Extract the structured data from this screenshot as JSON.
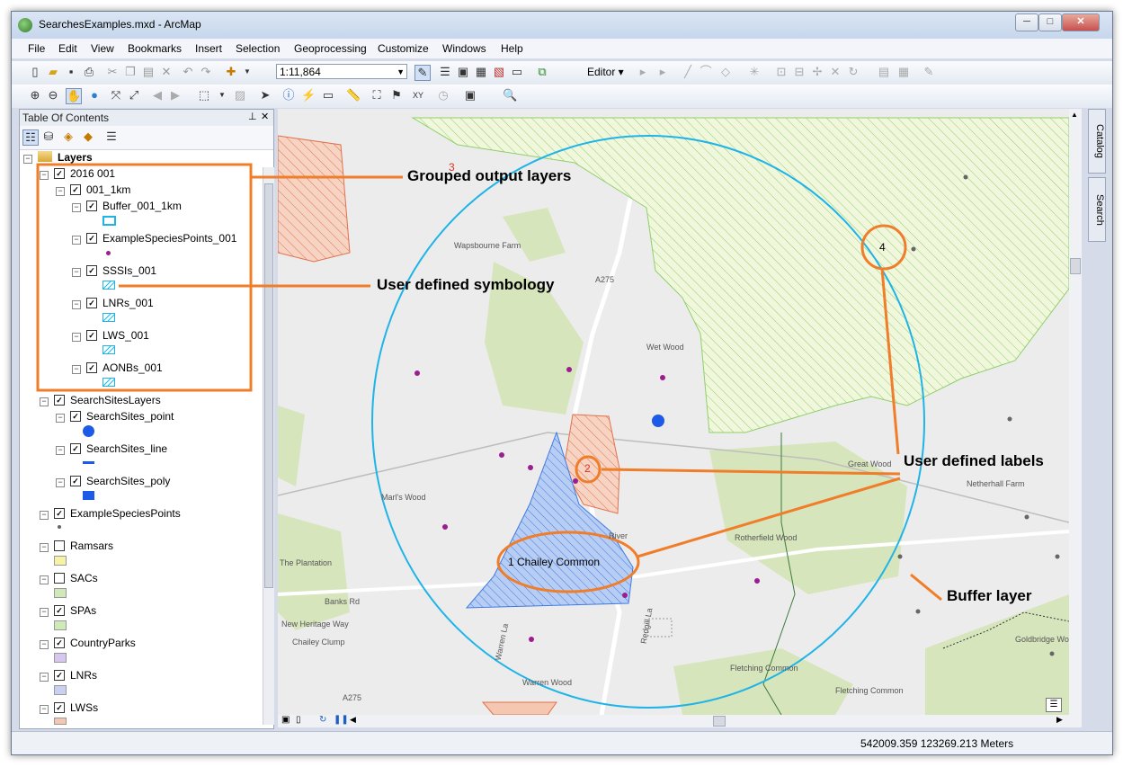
{
  "window": {
    "title": "SearchesExamples.mxd - ArcMap"
  },
  "menu": [
    "File",
    "Edit",
    "View",
    "Bookmarks",
    "Insert",
    "Selection",
    "Geoprocessing",
    "Customize",
    "Windows",
    "Help"
  ],
  "toolbar": {
    "scale": "1:11,864",
    "editor_label": "Editor ▾"
  },
  "toc": {
    "title": "Table Of Contents",
    "root": "Layers",
    "items": [
      {
        "label": "2016 001",
        "checked": true
      },
      {
        "label": "001_1km",
        "checked": true
      },
      {
        "label": "Buffer_001_1km",
        "checked": true
      },
      {
        "label": "ExampleSpeciesPoints_001",
        "checked": true
      },
      {
        "label": "SSSIs_001",
        "checked": true
      },
      {
        "label": "LNRs_001",
        "checked": true
      },
      {
        "label": "LWS_001",
        "checked": true
      },
      {
        "label": "AONBs_001",
        "checked": true
      },
      {
        "label": "SearchSitesLayers",
        "checked": true
      },
      {
        "label": "SearchSites_point",
        "checked": true
      },
      {
        "label": "SearchSites_line",
        "checked": true
      },
      {
        "label": "SearchSites_poly",
        "checked": true
      },
      {
        "label": "ExampleSpeciesPoints",
        "checked": true
      },
      {
        "label": "Ramsars",
        "checked": false
      },
      {
        "label": "SACs",
        "checked": false
      },
      {
        "label": "SPAs",
        "checked": true
      },
      {
        "label": "CountryParks",
        "checked": true
      },
      {
        "label": "LNRs",
        "checked": true
      },
      {
        "label": "LWSs",
        "checked": true
      }
    ]
  },
  "side_tabs": [
    "Catalog",
    "Search"
  ],
  "map": {
    "labels": {
      "farm_wapsbourne": "Wapsbourne Farm",
      "road_a275_top": "A275",
      "wet_wood": "Wet Wood",
      "great_wood": "Great Wood",
      "netherhall": "Netherhall Farm",
      "marls_wood": "Marl's Wood",
      "river": "River",
      "rotherfield": "Rotherfield Wood",
      "plantation": "The Plantation",
      "banks_rd": "Banks Rd",
      "new_heritage": "New Heritage Way",
      "chailey_clump": "Chailey Clump",
      "a275_bottom": "A275",
      "warren_wood": "Warren Wood",
      "fletching_common_wood": "Fletching Common",
      "fletching_common": "Fletching Common",
      "goldbridge": "Goldbridge Wood",
      "redgill": "Redgill La",
      "warren_la": "Warren La"
    },
    "feature_labels": {
      "l1": "1 Chailey Common",
      "l2": "2",
      "l3": "3",
      "l4": "4"
    }
  },
  "annotations": {
    "grouped": "Grouped output layers",
    "symbology": "User defined symbology",
    "labels": "User defined labels",
    "buffer": "Buffer layer"
  },
  "status": {
    "coords": "542009.359  123269.213 Meters"
  },
  "colors": {
    "buffer": "#1eb4e8",
    "annotation": "#f07d2a",
    "sssi": "#e8a081",
    "lws": "#8fd07a",
    "search_poly": "#1d5ae8",
    "species": "#9b1e8f"
  }
}
